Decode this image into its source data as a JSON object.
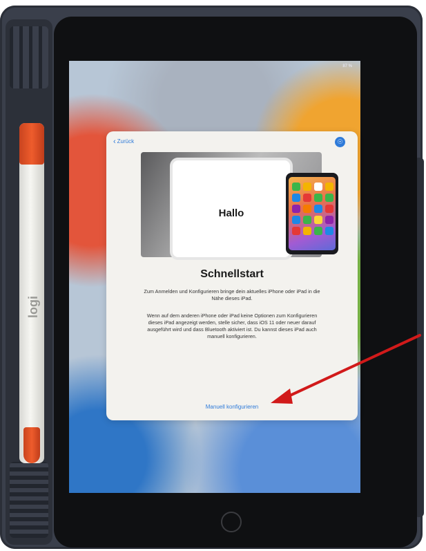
{
  "device": {
    "status": "87 %",
    "accessory": {
      "brand": "logi"
    }
  },
  "setup": {
    "back_label": "Zurück",
    "accessibility_icon": "accessibility-icon",
    "illustration": {
      "greeting": "Hallo"
    },
    "title": "Schnellstart",
    "paragraph1": "Zum Anmelden und Konfigurieren bringe dein aktuelles iPhone oder iPad in die Nähe dieses iPad.",
    "paragraph2": "Wenn auf dem anderen iPhone oder iPad keine Optionen zum Konfigurieren dieses iPad angezeigt werden, stelle sicher, dass iOS 11 oder neuer darauf ausgeführt wird und dass Bluetooth aktiviert ist. Du kannst dieses iPad auch manuell konfigurieren.",
    "manual_label": "Manuell konfigurieren"
  },
  "colors": {
    "accent": "#2f7bd9",
    "annotation_arrow": "#d11a1a",
    "pencil": "#ee5c2c",
    "app_icons": [
      "#3bb54a",
      "#f4b400",
      "#ffffff",
      "#f4b400",
      "#1e88e5",
      "#e53935",
      "#3bb54a",
      "#3bb54a",
      "#8e24aa",
      "#f57c00",
      "#1e88e5",
      "#e53935",
      "#1e88e5",
      "#3bb54a",
      "#fdd835",
      "#8e24aa",
      "#e53935",
      "#f4b400",
      "#3bb54a",
      "#1e88e5"
    ]
  }
}
